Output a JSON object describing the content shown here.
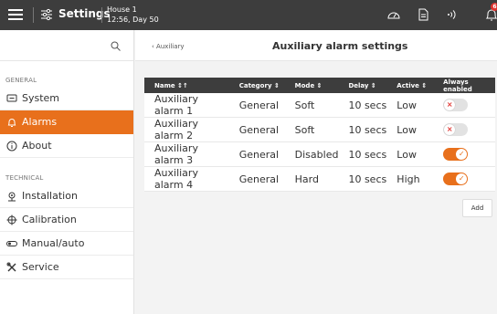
{
  "topbar": {
    "title": "Settings",
    "house_name": "House 1",
    "house_time": "12:56, Day 50",
    "notification_count": "6"
  },
  "sidebar": {
    "search_icon": "search-icon",
    "groups": [
      {
        "label": "GENERAL"
      },
      {
        "label": "TECHNICAL"
      }
    ],
    "items": [
      {
        "label": "System",
        "icon": "monitor-icon",
        "active": false
      },
      {
        "label": "Alarms",
        "icon": "bell-icon",
        "active": true
      },
      {
        "label": "About",
        "icon": "info-icon",
        "active": false
      },
      {
        "label": "Installation",
        "icon": "installation-icon",
        "active": false
      },
      {
        "label": "Calibration",
        "icon": "calibration-icon",
        "active": false
      },
      {
        "label": "Manual/auto",
        "icon": "toggle-icon",
        "active": false
      },
      {
        "label": "Service",
        "icon": "tools-icon",
        "active": false
      }
    ]
  },
  "main": {
    "breadcrumb": "‹ Auxiliary",
    "title": "Auxiliary alarm settings",
    "columns": [
      "Name ↕↑",
      "Category ⇕",
      "Mode ⇕",
      "Delay ⇕",
      "Active ⇕",
      "Always enabled"
    ],
    "rows": [
      {
        "name": "Auxiliary alarm 1",
        "category": "General",
        "mode": "Soft",
        "delay": "10 secs",
        "active": "Low",
        "always_enabled": false
      },
      {
        "name": "Auxiliary alarm 2",
        "category": "General",
        "mode": "Soft",
        "delay": "10 secs",
        "active": "Low",
        "always_enabled": false
      },
      {
        "name": "Auxiliary alarm 3",
        "category": "General",
        "mode": "Disabled",
        "delay": "10 secs",
        "active": "Low",
        "always_enabled": true
      },
      {
        "name": "Auxiliary alarm 4",
        "category": "General",
        "mode": "Hard",
        "delay": "10 secs",
        "active": "High",
        "always_enabled": true
      }
    ],
    "add_label": "Add"
  },
  "colors": {
    "accent": "#e8701c",
    "topbar": "#3d3d3d",
    "off_mark": "#e0332f"
  }
}
